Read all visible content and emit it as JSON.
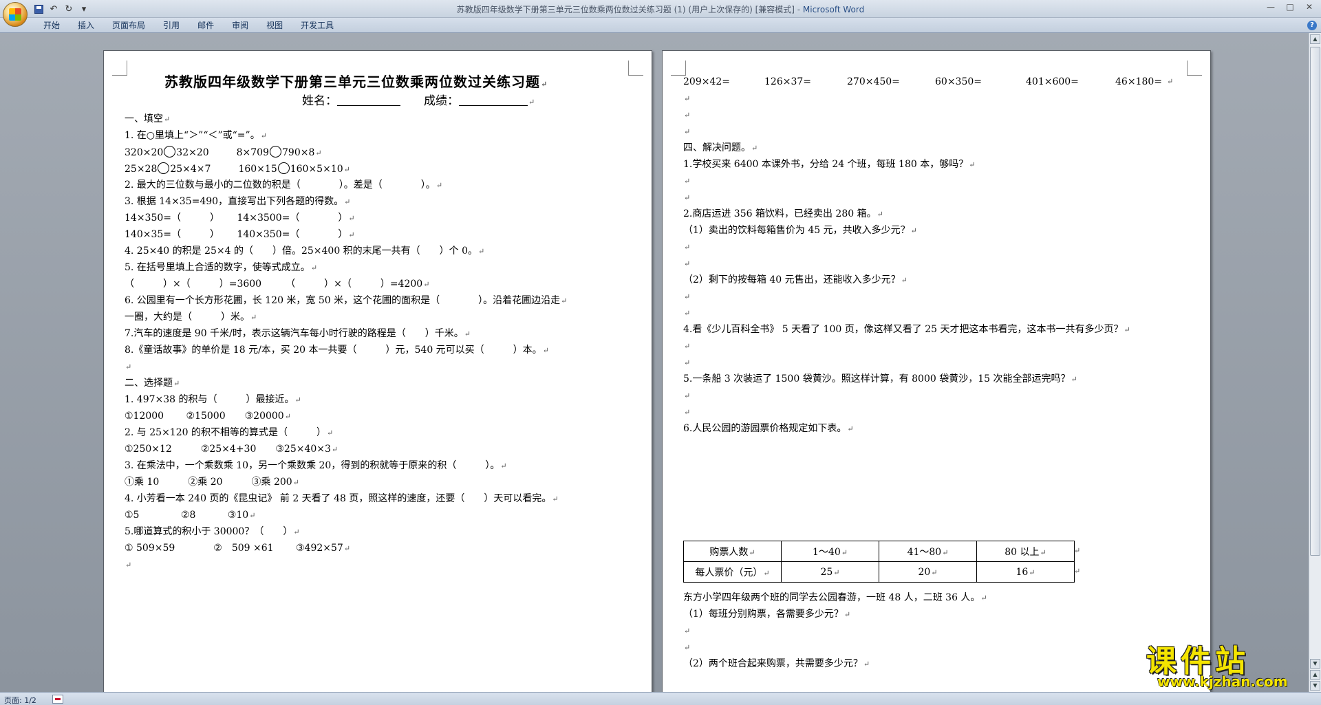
{
  "window": {
    "title": "苏教版四年级数学下册第三单元三位数乘两位数过关练习题 (1) (用户上次保存的) [兼容模式] - ",
    "app_name": "Microsoft Word",
    "minimize": "—",
    "maximize": "□",
    "close": "✕"
  },
  "qat": {
    "undo": "↶",
    "redo": "↻",
    "dropdown": "▾"
  },
  "ribbon": {
    "tabs": [
      "开始",
      "插入",
      "页面布局",
      "引用",
      "邮件",
      "审阅",
      "视图",
      "开发工具"
    ],
    "help": "?"
  },
  "page1": {
    "title": "苏教版四年级数学下册第三单元三位数乘两位数过关练习题",
    "name_label": "姓名：",
    "score_label": "成绩：",
    "lines": [
      "一、填空",
      "1. 在○里填上“＞”“＜”或“=”。",
      "",
      "",
      "2. 最大的三位数与最小的二位数的积是（　　　　）。差是（　　　　）。",
      "3. 根据 14×35=490，直接写出下列各题的得数。",
      "14×350=（　　　）　　 14×3500=（　　　　）",
      "140×35=（　　　）　　 140×350=（　　　　）",
      "4. 25×40 的积是 25×4 的（　　）倍。25×400 积的末尾一共有（　　）个 0。",
      "5. 在括号里填上合适的数字，使等式成立。",
      "（　　　）×（　　　）=3600　　　（　　　）×（　　　）=4200",
      "6. 公园里有一个长方形花圃，长 120 米，宽 50 米，这个花圃的面积是（　　　　）。沿着花圃边沿走",
      "一圈，大约是（　　　）米。",
      "7.汽车的速度是 90 千米/时，表示这辆汽车每小时行驶的路程是（　　）千米。",
      "8.《童话故事》的单价是 18 元/本，买 20 本一共要（　　　）元，540 元可以买（　　　）本。",
      "",
      "二、选择题",
      "1. 497×38 的积与（　　　）最接近。",
      "①12000　　 ②15000　　③20000",
      "2. 与 25×120 的积不相等的算式是（　　　）",
      "①250×12　　　②25×4+30　　③25×40×3",
      "3. 在乘法中，一个乘数乘 10，另一个乘数乘 20，得到的积就等于原来的积（　　　）。",
      "①乘 10　　　②乘 20　　　③乘 200",
      "4. 小芳看一本 240 页的《昆虫记》 前 2 天看了 48 页，照这样的速度，还要（　　）天可以看完。",
      "①5　　　　 ②8　　　 ③10",
      "5.哪道算式的积小于 30000？（　　）",
      "① 509×59　　　　②　509 ×61　　 ③492×57",
      ""
    ],
    "compare_row1": {
      "a": "320×20",
      "b": "32×20",
      "c": "8×709",
      "d": "790×8"
    },
    "compare_row2": {
      "a": "25×28",
      "b": "25×4×7",
      "c": "160×15",
      "d": "160×5×10"
    }
  },
  "page2": {
    "calc_row": [
      "209×42=",
      "126×37=",
      "270×450=",
      "60×350=",
      "401×600=",
      "46×180="
    ],
    "lines": [
      "",
      "",
      "",
      "四、解决问题。",
      "1.学校买来 6400 本课外书，分给 24 个班，每班 180 本，够吗？",
      "",
      "",
      "2.商店运进 356 箱饮料，已经卖出 280 箱。",
      "（1）卖出的饮料每箱售价为 45 元，共收入多少元？",
      "",
      "",
      "（2）剩下的按每箱 40 元售出，还能收入多少元？",
      "",
      "",
      "4.看《少儿百科全书》 5 天看了 100 页，像这样又看了 25 天才把这本书看完，这本书一共有多少页？",
      "",
      "",
      "5.一条船 3 次装运了 1500 袋黄沙。照这样计算，有 8000 袋黄沙，15 次能全部运完吗？",
      "",
      "",
      "6.人民公园的游园票价格规定如下表。"
    ],
    "table": {
      "rows": [
        [
          "购票人数",
          "1～40",
          "41～80",
          "80 以上"
        ],
        [
          "每人票价（元）",
          "25",
          "20",
          "16"
        ]
      ]
    },
    "after_table": [
      "东方小学四年级两个班的同学去公园春游，一班 48 人，二班 36 人。",
      "（1）每班分别购票，各需要多少元？",
      "",
      "",
      "（2）两个班合起来购票，共需要多少元？"
    ]
  },
  "status": {
    "page": "页面: 1/2"
  },
  "watermark": {
    "big": "课件站",
    "small": "www.kjzhan.com"
  }
}
